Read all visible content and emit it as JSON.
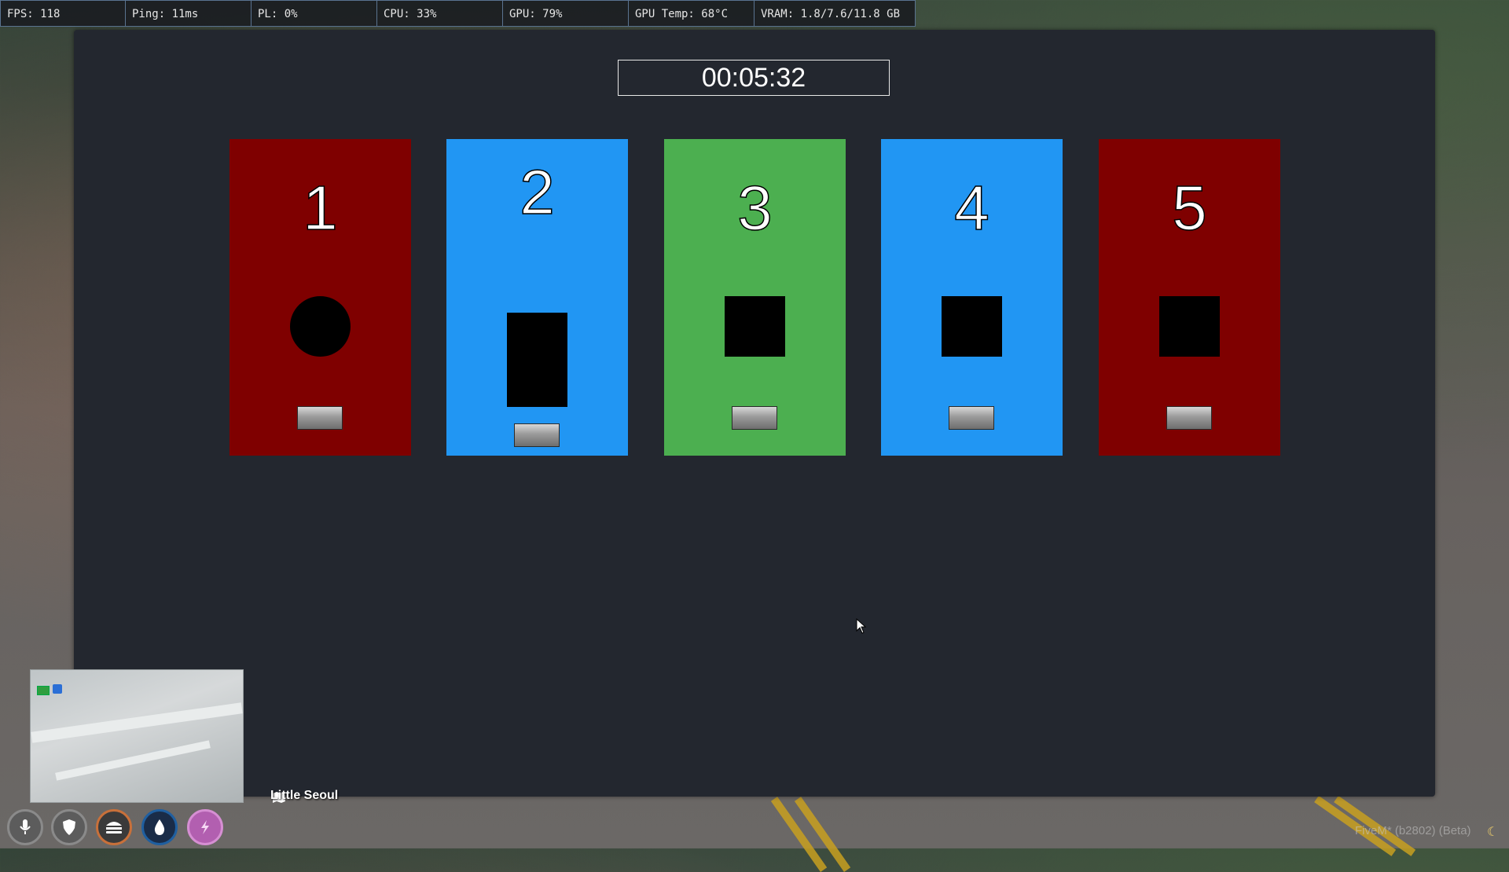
{
  "perf_bar": [
    {
      "label": "FPS: 118"
    },
    {
      "label": "Ping: 11ms"
    },
    {
      "label": "PL: 0%"
    },
    {
      "label": "CPU: 33%"
    },
    {
      "label": "GPU: 79%"
    },
    {
      "label": "GPU Temp: 68°C"
    },
    {
      "label": "VRAM: 1.8/7.6/11.8 GB"
    }
  ],
  "minigame": {
    "timer": "00:05:32",
    "cards": [
      {
        "number": "1",
        "color": "#7f0000",
        "shape": "circle"
      },
      {
        "number": "2",
        "color": "#2196f3",
        "shape": "rectangle"
      },
      {
        "number": "3",
        "color": "#4caf50",
        "shape": "square"
      },
      {
        "number": "4",
        "color": "#2196f3",
        "shape": "square"
      },
      {
        "number": "5",
        "color": "#7f0000",
        "shape": "square"
      }
    ]
  },
  "hud": {
    "street": "Little Seoul",
    "status_icons": [
      {
        "name": "microphone-icon",
        "color": "#6a6a6a"
      },
      {
        "name": "shield-icon",
        "color": "#6a6a6a"
      },
      {
        "name": "burger-icon",
        "color": "#c8703a"
      },
      {
        "name": "water-drop-icon",
        "color": "#1f5fa0"
      },
      {
        "name": "lightning-icon",
        "color": "#c26bbf"
      }
    ],
    "watermark": "FiveM* (b2802) (Beta)"
  }
}
